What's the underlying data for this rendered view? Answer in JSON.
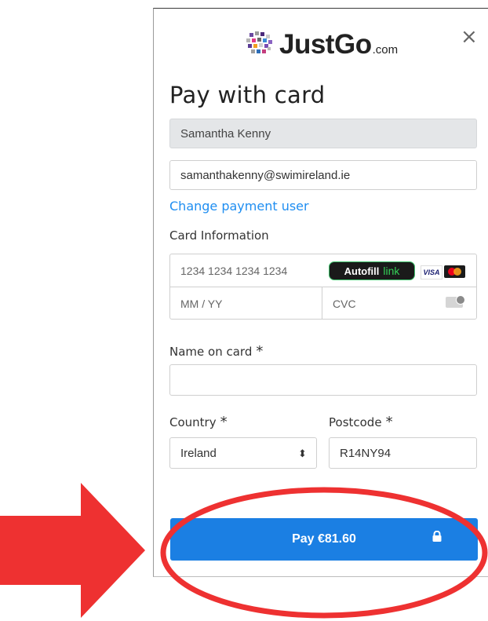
{
  "brand": {
    "name": "JustGo",
    "domain": ".com"
  },
  "close_label": "×",
  "title": "Pay with card",
  "payer": {
    "name": "Samantha Kenny",
    "email": "samanthakenny@swimireland.ie"
  },
  "change_user_link": "Change payment user",
  "card": {
    "section_label": "Card Information",
    "number_placeholder": "1234 1234 1234 1234",
    "autofill_label": "Autofill",
    "autofill_link": "link",
    "visa_label": "VISA",
    "expiry_placeholder": "MM / YY",
    "cvc_placeholder": "CVC"
  },
  "name_on_card": {
    "label": "Name on card",
    "required_mark": "*",
    "value": ""
  },
  "country": {
    "label": "Country",
    "required_mark": "*",
    "value": "Ireland",
    "arrow": "⬍"
  },
  "postcode": {
    "label": "Postcode",
    "required_mark": "*",
    "value": "R14NY94"
  },
  "pay_button": {
    "label": "Pay €81.60"
  },
  "colors": {
    "accent": "#1b7fe3",
    "link": "#1f8ef1",
    "annotation_red": "#ee3131",
    "autofill_green": "#34d058"
  }
}
